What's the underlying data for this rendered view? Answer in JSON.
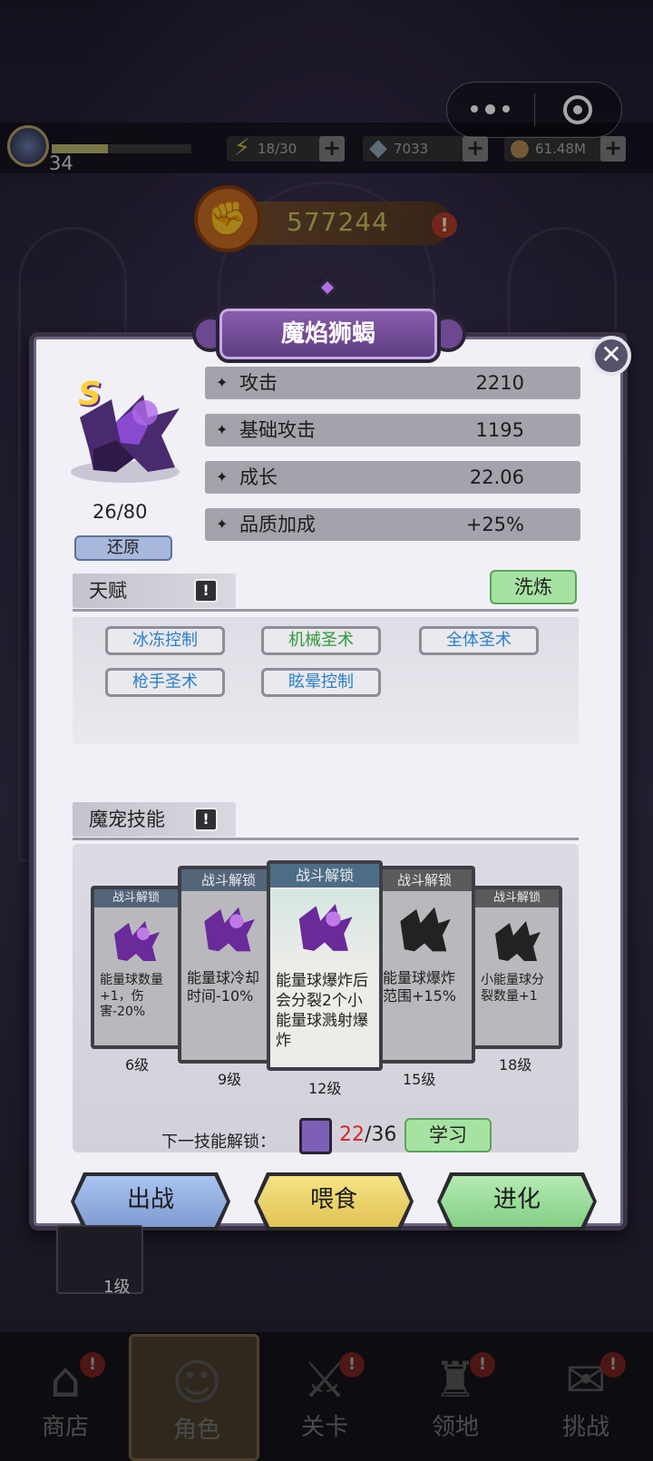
{
  "capsule": {
    "more_icon": "more-dots-icon",
    "close_icon": "target-icon"
  },
  "top": {
    "level": "34",
    "xp_fraction": 0.4,
    "energy": "18/30",
    "diamonds": "7033",
    "coins": "61.48M"
  },
  "power": {
    "value": "577244"
  },
  "pet": {
    "name": "魔焰狮蝎",
    "rank": "S",
    "level": "26/80",
    "restore_label": "还原"
  },
  "stats": [
    {
      "name": "攻击",
      "value": "2210"
    },
    {
      "name": "基础攻击",
      "value": "1195"
    },
    {
      "name": "成长",
      "value": "22.06"
    },
    {
      "name": "品质加成",
      "value": "+25%"
    }
  ],
  "talent": {
    "title": "天赋",
    "wash_label": "洗炼",
    "items": [
      {
        "label": "冰冻控制",
        "color": "#2a7fc8"
      },
      {
        "label": "机械圣术",
        "color": "#2e9a3a"
      },
      {
        "label": "全体圣术",
        "color": "#2a7fc8"
      },
      {
        "label": "枪手圣术",
        "color": "#2a7fc8"
      },
      {
        "label": "眩晕控制",
        "color": "#2a7fc8"
      }
    ]
  },
  "skills": {
    "title": "魔宠技能",
    "cards": [
      {
        "head": "战斗解锁",
        "desc": "能量球数量+1，伤害-20%",
        "level": "6级"
      },
      {
        "head": "战斗解锁",
        "desc": "能量球冷却时间-10%",
        "level": "9级"
      },
      {
        "head": "战斗解锁",
        "desc": "能量球爆炸后会分裂2个小能量球溅射爆炸",
        "level": "12级"
      },
      {
        "head": "战斗解锁",
        "desc": "能量球爆炸范围+15%",
        "level": "15级"
      },
      {
        "head": "战斗解锁",
        "desc": "小能量球分裂数量+1",
        "level": "18级"
      }
    ],
    "next_unlock_label": "下一技能解锁：",
    "book_current": "22",
    "book_total": "/36",
    "learn_label": "学习"
  },
  "actions": {
    "deploy": "出战",
    "feed": "喂食",
    "evolve": "进化"
  },
  "stub_level": "1级",
  "nav": [
    {
      "label": "商店",
      "icon": "shop-icon",
      "badge": "!"
    },
    {
      "label": "角色",
      "icon": "character-icon",
      "badge": ""
    },
    {
      "label": "关卡",
      "icon": "crossed-swords-icon",
      "badge": "!"
    },
    {
      "label": "领地",
      "icon": "castle-icon",
      "badge": "!"
    },
    {
      "label": "挑战",
      "icon": "scroll-icon",
      "badge": "!"
    }
  ]
}
